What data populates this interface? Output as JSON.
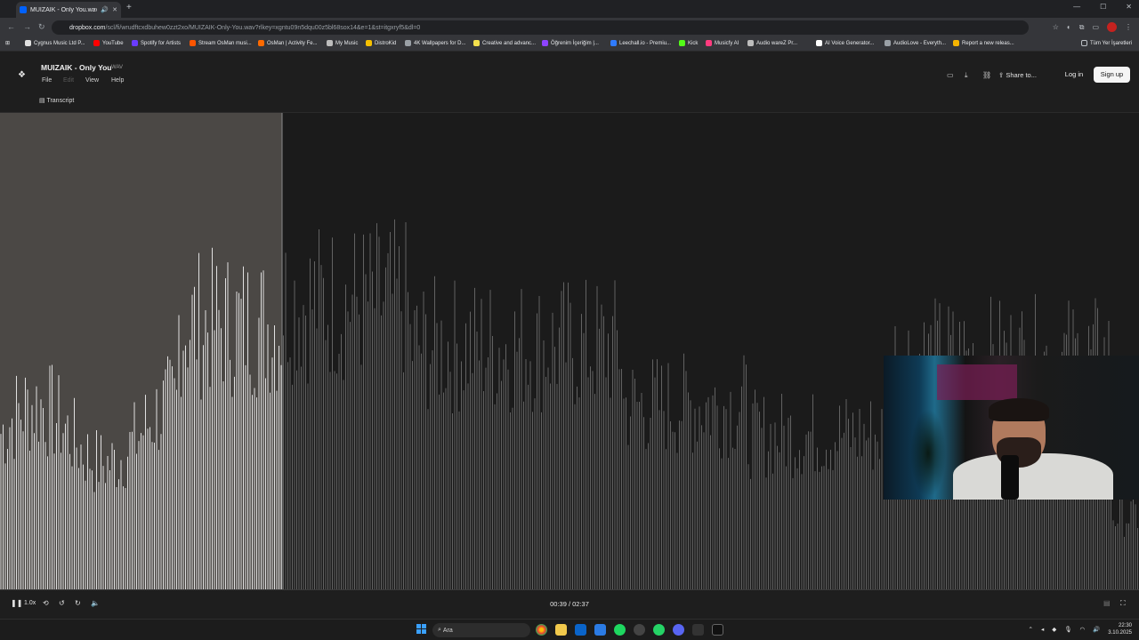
{
  "browser": {
    "tab_title": "MUIZAIK - Only You.wav",
    "url_host": "dropbox.com",
    "url_path": "/scl/fi/wrudftcxdbuhew0zzt2xo/MUIZAIK-Only-You.wav?rlkey=xgntu09n5dqu00z5bl68sox14&e=1&st=itgxryf5&dl=0",
    "new_tab_icon": "plus-icon"
  },
  "bookmarks": [
    {
      "label": "Cygnus Music Ltd P...",
      "color": "#e0e0e0"
    },
    {
      "label": "YouTube",
      "color": "#ff0000"
    },
    {
      "label": "Spotify for Artists",
      "color": "#6a3cff"
    },
    {
      "label": "Stream OsMan musi...",
      "color": "#ff5500"
    },
    {
      "label": "OsMan | Activity Fe...",
      "color": "#ff6a00"
    },
    {
      "label": "My Music",
      "color": "#bdbdbd"
    },
    {
      "label": "DistroKid",
      "color": "#f6c000"
    },
    {
      "label": "4K Wallpapers for D...",
      "color": "#9aa0a6"
    },
    {
      "label": "Creative and advanc...",
      "color": "#f4e04d"
    },
    {
      "label": "Öğrenim İçeriğim |...",
      "color": "#8e44ff"
    },
    {
      "label": "Leechall.io - Premiu...",
      "color": "#2f7bff"
    },
    {
      "label": "Kick",
      "color": "#53fc18"
    },
    {
      "label": "Musicfy AI",
      "color": "#ff3b7f"
    },
    {
      "label": "Audio wareZ Pr...",
      "color": "#bdbdbd"
    },
    {
      "label": "AI Voice Generator...",
      "color": "#ffffff"
    },
    {
      "label": "AudioLove - Everyth...",
      "color": "#9aa0a6"
    },
    {
      "label": "Report a new releas...",
      "color": "#f5b400"
    }
  ],
  "bookmarks_other": "Tüm Yer İşaretleri",
  "app": {
    "file_title": "MUIZAIK - Only You",
    "file_ext": "WAV",
    "menu": [
      "File",
      "Edit",
      "View",
      "Help"
    ],
    "transcript_label": "Transcript",
    "share_label": "Share to...",
    "login_label": "Log in",
    "signup_label": "Sign up"
  },
  "player": {
    "speed_label": "1.0x",
    "current_time": "00:39",
    "duration": "02:37",
    "time_display": "00:39 / 02:37",
    "progress_fraction": 0.248
  },
  "taskbar": {
    "search_placeholder": "Ara",
    "time": "22:30",
    "date": "3.10.2025"
  }
}
